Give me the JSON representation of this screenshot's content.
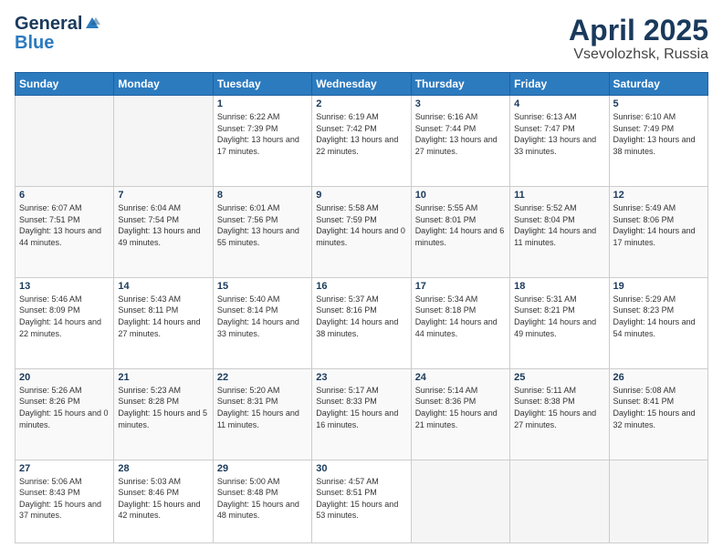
{
  "logo": {
    "general": "General",
    "blue": "Blue"
  },
  "header": {
    "title": "April 2025",
    "subtitle": "Vsevolozhsk, Russia"
  },
  "weekdays": [
    "Sunday",
    "Monday",
    "Tuesday",
    "Wednesday",
    "Thursday",
    "Friday",
    "Saturday"
  ],
  "days": [
    {
      "date": null,
      "empty": true
    },
    {
      "date": null,
      "empty": true
    },
    {
      "date": 1,
      "sunrise": "6:22 AM",
      "sunset": "7:39 PM",
      "daylight": "13 hours and 17 minutes."
    },
    {
      "date": 2,
      "sunrise": "6:19 AM",
      "sunset": "7:42 PM",
      "daylight": "13 hours and 22 minutes."
    },
    {
      "date": 3,
      "sunrise": "6:16 AM",
      "sunset": "7:44 PM",
      "daylight": "13 hours and 27 minutes."
    },
    {
      "date": 4,
      "sunrise": "6:13 AM",
      "sunset": "7:47 PM",
      "daylight": "13 hours and 33 minutes."
    },
    {
      "date": 5,
      "sunrise": "6:10 AM",
      "sunset": "7:49 PM",
      "daylight": "13 hours and 38 minutes."
    },
    {
      "date": 6,
      "sunrise": "6:07 AM",
      "sunset": "7:51 PM",
      "daylight": "13 hours and 44 minutes."
    },
    {
      "date": 7,
      "sunrise": "6:04 AM",
      "sunset": "7:54 PM",
      "daylight": "13 hours and 49 minutes."
    },
    {
      "date": 8,
      "sunrise": "6:01 AM",
      "sunset": "7:56 PM",
      "daylight": "13 hours and 55 minutes."
    },
    {
      "date": 9,
      "sunrise": "5:58 AM",
      "sunset": "7:59 PM",
      "daylight": "14 hours and 0 minutes."
    },
    {
      "date": 10,
      "sunrise": "5:55 AM",
      "sunset": "8:01 PM",
      "daylight": "14 hours and 6 minutes."
    },
    {
      "date": 11,
      "sunrise": "5:52 AM",
      "sunset": "8:04 PM",
      "daylight": "14 hours and 11 minutes."
    },
    {
      "date": 12,
      "sunrise": "5:49 AM",
      "sunset": "8:06 PM",
      "daylight": "14 hours and 17 minutes."
    },
    {
      "date": 13,
      "sunrise": "5:46 AM",
      "sunset": "8:09 PM",
      "daylight": "14 hours and 22 minutes."
    },
    {
      "date": 14,
      "sunrise": "5:43 AM",
      "sunset": "8:11 PM",
      "daylight": "14 hours and 27 minutes."
    },
    {
      "date": 15,
      "sunrise": "5:40 AM",
      "sunset": "8:14 PM",
      "daylight": "14 hours and 33 minutes."
    },
    {
      "date": 16,
      "sunrise": "5:37 AM",
      "sunset": "8:16 PM",
      "daylight": "14 hours and 38 minutes."
    },
    {
      "date": 17,
      "sunrise": "5:34 AM",
      "sunset": "8:18 PM",
      "daylight": "14 hours and 44 minutes."
    },
    {
      "date": 18,
      "sunrise": "5:31 AM",
      "sunset": "8:21 PM",
      "daylight": "14 hours and 49 minutes."
    },
    {
      "date": 19,
      "sunrise": "5:29 AM",
      "sunset": "8:23 PM",
      "daylight": "14 hours and 54 minutes."
    },
    {
      "date": 20,
      "sunrise": "5:26 AM",
      "sunset": "8:26 PM",
      "daylight": "15 hours and 0 minutes."
    },
    {
      "date": 21,
      "sunrise": "5:23 AM",
      "sunset": "8:28 PM",
      "daylight": "15 hours and 5 minutes."
    },
    {
      "date": 22,
      "sunrise": "5:20 AM",
      "sunset": "8:31 PM",
      "daylight": "15 hours and 11 minutes."
    },
    {
      "date": 23,
      "sunrise": "5:17 AM",
      "sunset": "8:33 PM",
      "daylight": "15 hours and 16 minutes."
    },
    {
      "date": 24,
      "sunrise": "5:14 AM",
      "sunset": "8:36 PM",
      "daylight": "15 hours and 21 minutes."
    },
    {
      "date": 25,
      "sunrise": "5:11 AM",
      "sunset": "8:38 PM",
      "daylight": "15 hours and 27 minutes."
    },
    {
      "date": 26,
      "sunrise": "5:08 AM",
      "sunset": "8:41 PM",
      "daylight": "15 hours and 32 minutes."
    },
    {
      "date": 27,
      "sunrise": "5:06 AM",
      "sunset": "8:43 PM",
      "daylight": "15 hours and 37 minutes."
    },
    {
      "date": 28,
      "sunrise": "5:03 AM",
      "sunset": "8:46 PM",
      "daylight": "15 hours and 42 minutes."
    },
    {
      "date": 29,
      "sunrise": "5:00 AM",
      "sunset": "8:48 PM",
      "daylight": "15 hours and 48 minutes."
    },
    {
      "date": 30,
      "sunrise": "4:57 AM",
      "sunset": "8:51 PM",
      "daylight": "15 hours and 53 minutes."
    },
    {
      "date": null,
      "empty": true
    },
    {
      "date": null,
      "empty": true
    },
    {
      "date": null,
      "empty": true
    }
  ],
  "labels": {
    "sunrise": "Sunrise:",
    "sunset": "Sunset:",
    "daylight": "Daylight:"
  }
}
